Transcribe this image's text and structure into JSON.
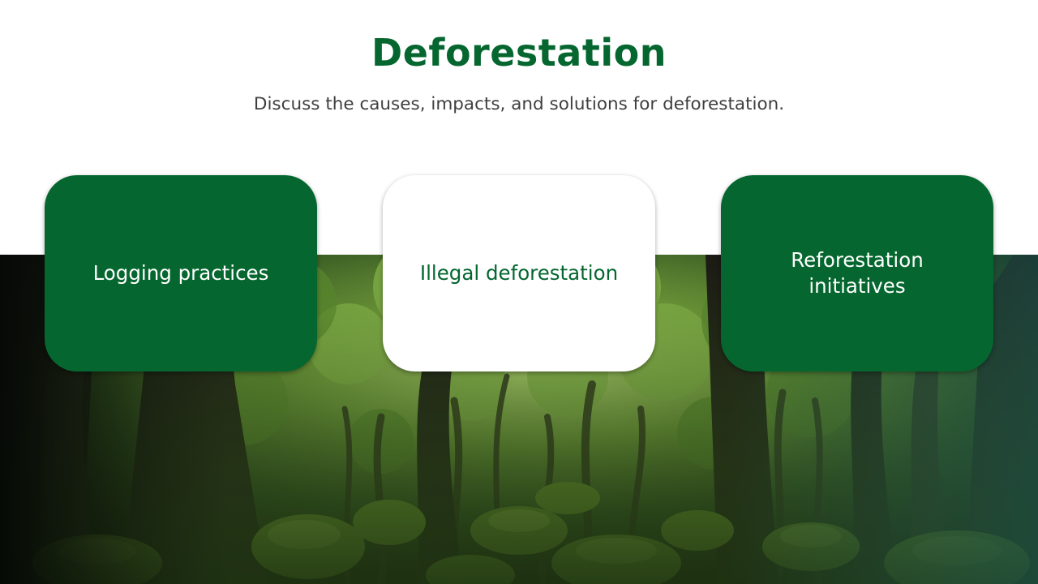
{
  "slide": {
    "title": "Deforestation",
    "subtitle": "Discuss the causes, impacts, and solutions for deforestation."
  },
  "cards": [
    {
      "label": "Logging practices",
      "style": "green"
    },
    {
      "label": "Illegal deforestation",
      "style": "white"
    },
    {
      "label": "Reforestation initiatives",
      "style": "green"
    }
  ],
  "background_image": {
    "subject": "dense green forest with mossy boulders and dark tree trunks"
  },
  "colors": {
    "accent": "#05672f",
    "text_dark": "#3f3f3f",
    "background": "#ffffff"
  }
}
